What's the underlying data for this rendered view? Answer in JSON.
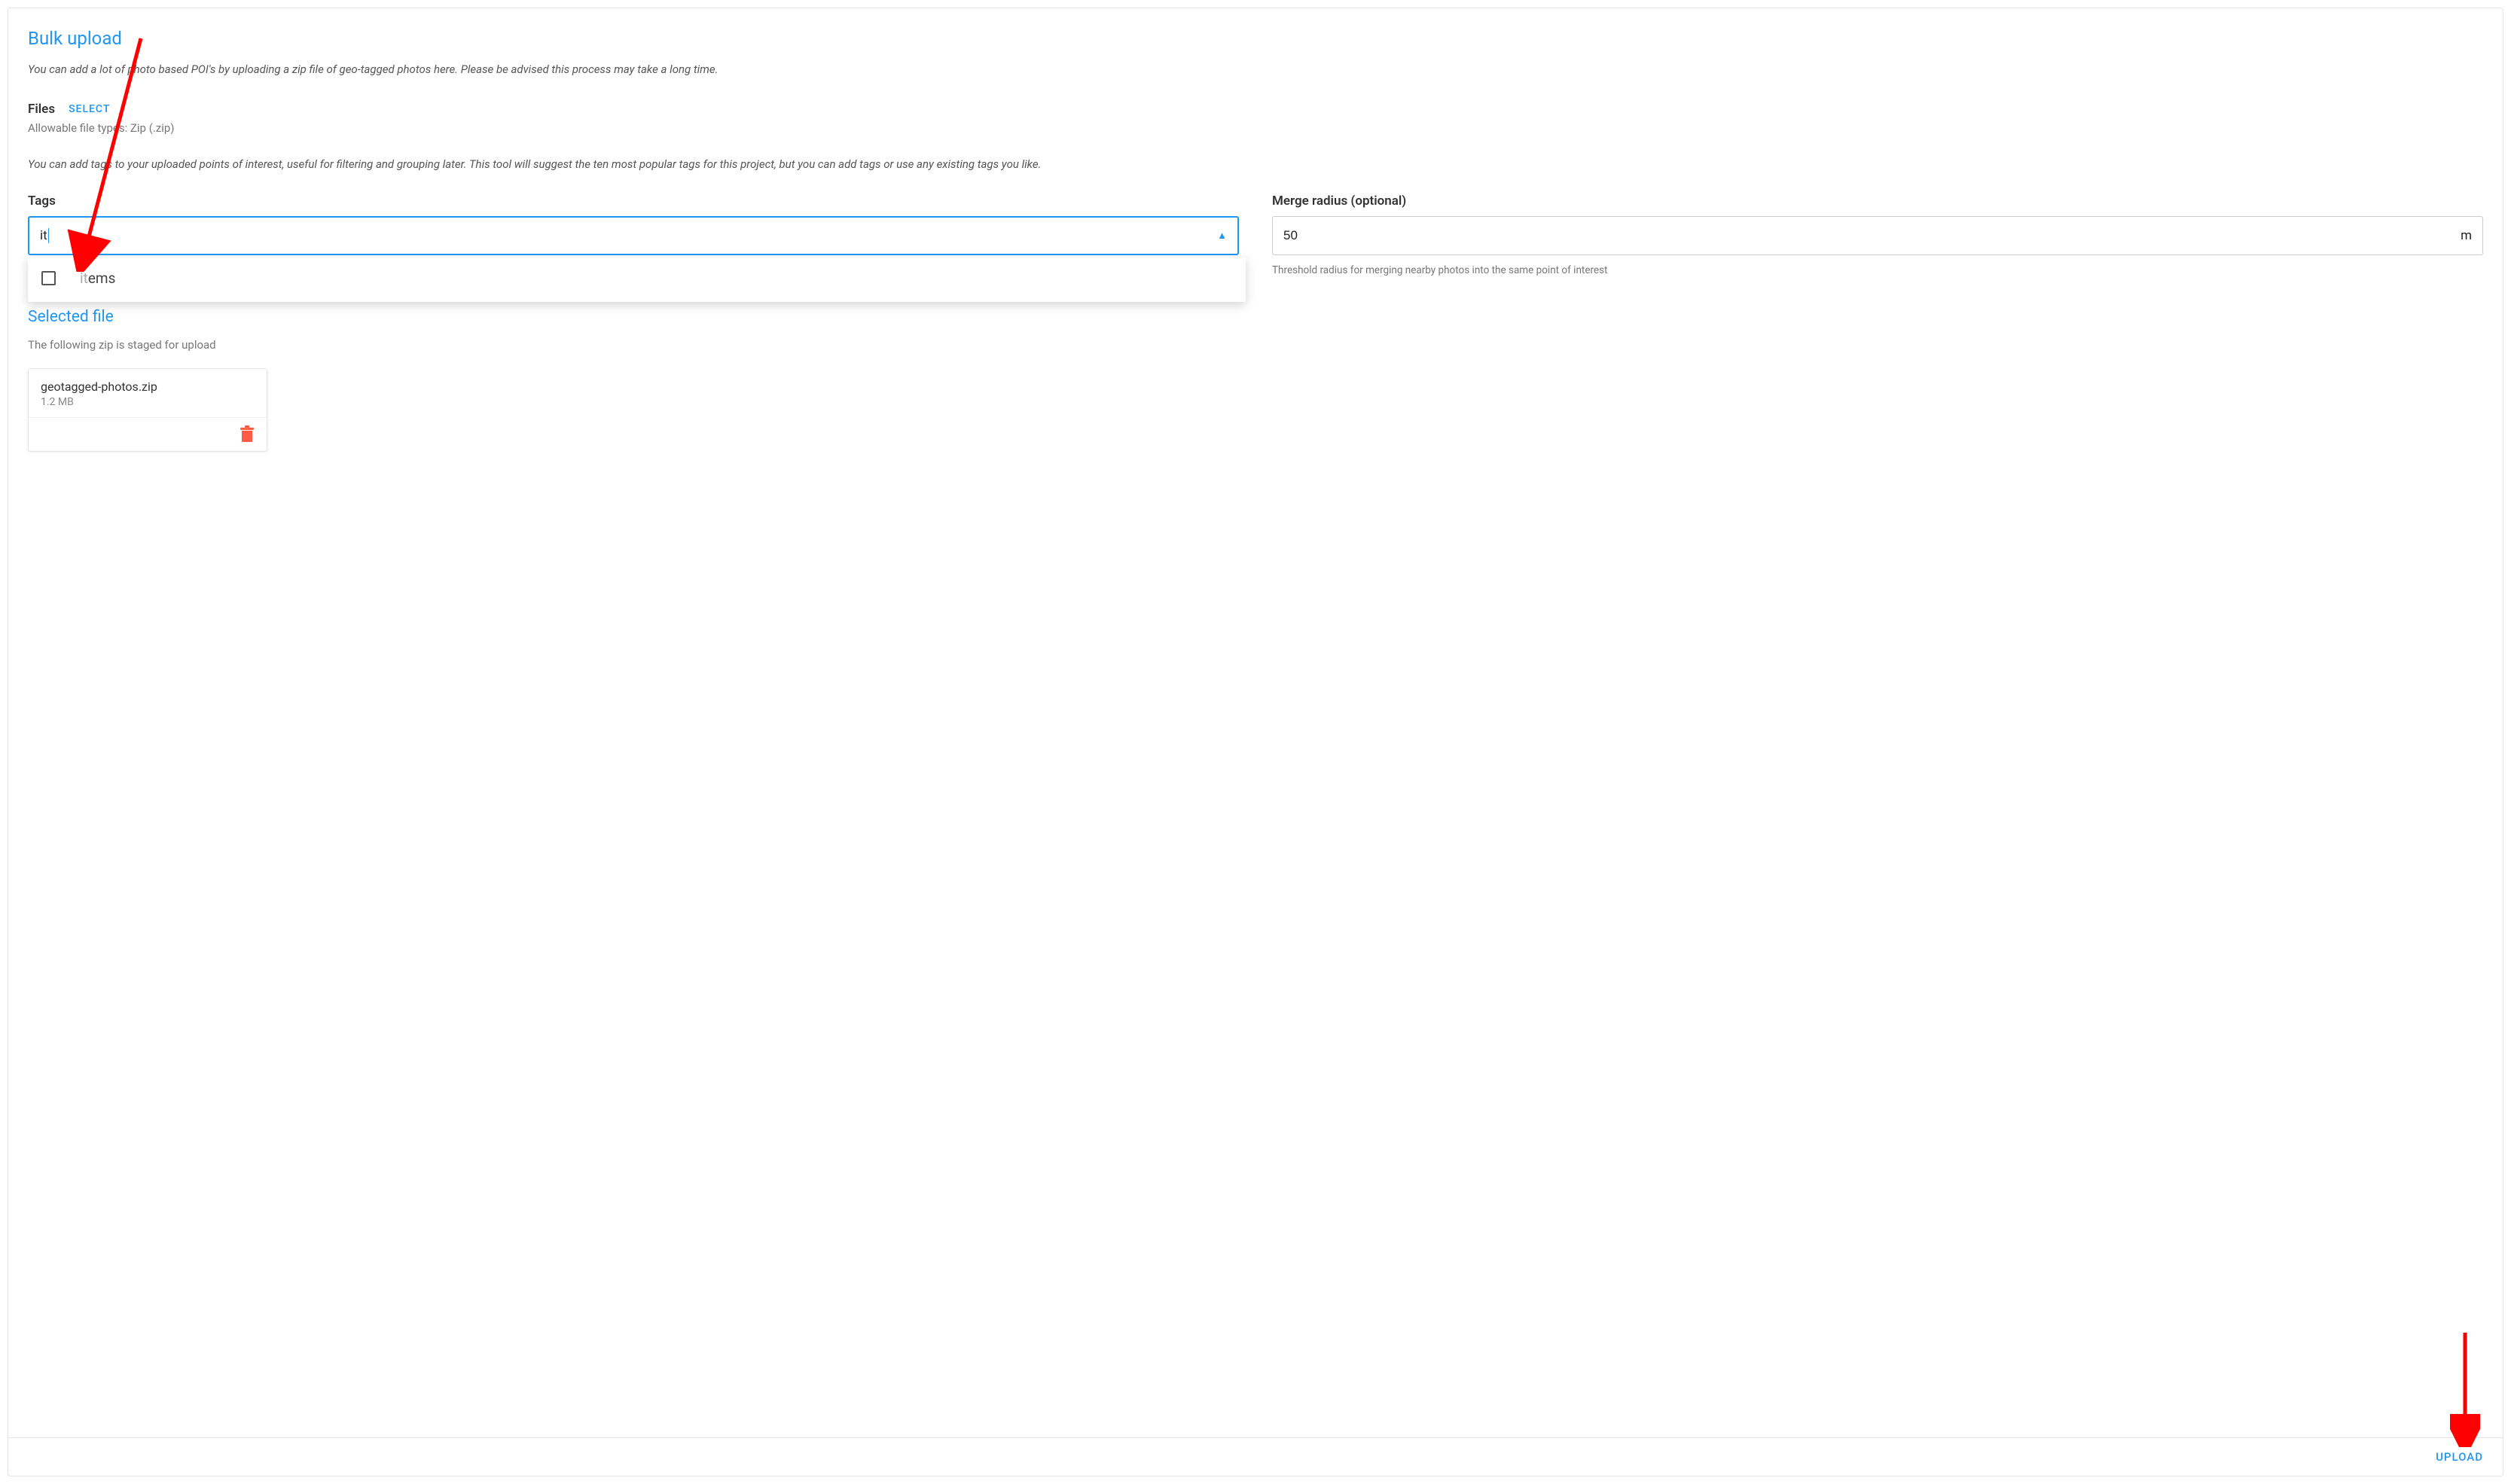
{
  "title": "Bulk upload",
  "intro": "You can add a lot of photo based POI's by uploading a zip file of geo-tagged photos here. Please be advised this process may take a long time.",
  "files": {
    "label": "Files",
    "select_label": "SELECT",
    "hint": "Allowable file types: Zip (.zip)"
  },
  "tags_intro": "You can add tags to your uploaded points of interest, useful for filtering and grouping later. This tool will suggest the ten most popular tags for this project, but you can add tags or use any existing tags you like.",
  "tags": {
    "label": "Tags",
    "value": "it",
    "suggestion_match": "it",
    "suggestion_rest": "ems"
  },
  "merge": {
    "label": "Merge radius (optional)",
    "value": "50",
    "unit": "m",
    "hint": "Threshold radius for merging nearby photos into the same point of interest"
  },
  "selected_file_heading": "Selected file",
  "staged_hint": "The following zip is staged for upload",
  "file": {
    "name": "geotagged-photos.zip",
    "size": "1.2 MB"
  },
  "upload_label": "UPLOAD"
}
